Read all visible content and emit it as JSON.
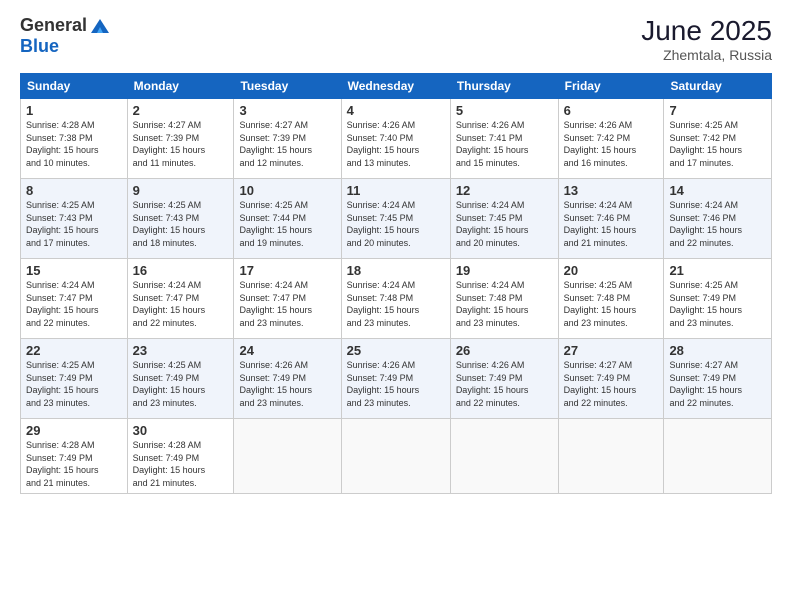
{
  "header": {
    "logo_general": "General",
    "logo_blue": "Blue",
    "title": "June 2025",
    "location": "Zhemtala, Russia"
  },
  "days_of_week": [
    "Sunday",
    "Monday",
    "Tuesday",
    "Wednesday",
    "Thursday",
    "Friday",
    "Saturday"
  ],
  "weeks": [
    [
      {
        "day": 1,
        "info": "Sunrise: 4:28 AM\nSunset: 7:38 PM\nDaylight: 15 hours\nand 10 minutes."
      },
      {
        "day": 2,
        "info": "Sunrise: 4:27 AM\nSunset: 7:39 PM\nDaylight: 15 hours\nand 11 minutes."
      },
      {
        "day": 3,
        "info": "Sunrise: 4:27 AM\nSunset: 7:39 PM\nDaylight: 15 hours\nand 12 minutes."
      },
      {
        "day": 4,
        "info": "Sunrise: 4:26 AM\nSunset: 7:40 PM\nDaylight: 15 hours\nand 13 minutes."
      },
      {
        "day": 5,
        "info": "Sunrise: 4:26 AM\nSunset: 7:41 PM\nDaylight: 15 hours\nand 15 minutes."
      },
      {
        "day": 6,
        "info": "Sunrise: 4:26 AM\nSunset: 7:42 PM\nDaylight: 15 hours\nand 16 minutes."
      },
      {
        "day": 7,
        "info": "Sunrise: 4:25 AM\nSunset: 7:42 PM\nDaylight: 15 hours\nand 17 minutes."
      }
    ],
    [
      {
        "day": 8,
        "info": "Sunrise: 4:25 AM\nSunset: 7:43 PM\nDaylight: 15 hours\nand 17 minutes."
      },
      {
        "day": 9,
        "info": "Sunrise: 4:25 AM\nSunset: 7:43 PM\nDaylight: 15 hours\nand 18 minutes."
      },
      {
        "day": 10,
        "info": "Sunrise: 4:25 AM\nSunset: 7:44 PM\nDaylight: 15 hours\nand 19 minutes."
      },
      {
        "day": 11,
        "info": "Sunrise: 4:24 AM\nSunset: 7:45 PM\nDaylight: 15 hours\nand 20 minutes."
      },
      {
        "day": 12,
        "info": "Sunrise: 4:24 AM\nSunset: 7:45 PM\nDaylight: 15 hours\nand 20 minutes."
      },
      {
        "day": 13,
        "info": "Sunrise: 4:24 AM\nSunset: 7:46 PM\nDaylight: 15 hours\nand 21 minutes."
      },
      {
        "day": 14,
        "info": "Sunrise: 4:24 AM\nSunset: 7:46 PM\nDaylight: 15 hours\nand 22 minutes."
      }
    ],
    [
      {
        "day": 15,
        "info": "Sunrise: 4:24 AM\nSunset: 7:47 PM\nDaylight: 15 hours\nand 22 minutes."
      },
      {
        "day": 16,
        "info": "Sunrise: 4:24 AM\nSunset: 7:47 PM\nDaylight: 15 hours\nand 22 minutes."
      },
      {
        "day": 17,
        "info": "Sunrise: 4:24 AM\nSunset: 7:47 PM\nDaylight: 15 hours\nand 23 minutes."
      },
      {
        "day": 18,
        "info": "Sunrise: 4:24 AM\nSunset: 7:48 PM\nDaylight: 15 hours\nand 23 minutes."
      },
      {
        "day": 19,
        "info": "Sunrise: 4:24 AM\nSunset: 7:48 PM\nDaylight: 15 hours\nand 23 minutes."
      },
      {
        "day": 20,
        "info": "Sunrise: 4:25 AM\nSunset: 7:48 PM\nDaylight: 15 hours\nand 23 minutes."
      },
      {
        "day": 21,
        "info": "Sunrise: 4:25 AM\nSunset: 7:49 PM\nDaylight: 15 hours\nand 23 minutes."
      }
    ],
    [
      {
        "day": 22,
        "info": "Sunrise: 4:25 AM\nSunset: 7:49 PM\nDaylight: 15 hours\nand 23 minutes."
      },
      {
        "day": 23,
        "info": "Sunrise: 4:25 AM\nSunset: 7:49 PM\nDaylight: 15 hours\nand 23 minutes."
      },
      {
        "day": 24,
        "info": "Sunrise: 4:26 AM\nSunset: 7:49 PM\nDaylight: 15 hours\nand 23 minutes."
      },
      {
        "day": 25,
        "info": "Sunrise: 4:26 AM\nSunset: 7:49 PM\nDaylight: 15 hours\nand 23 minutes."
      },
      {
        "day": 26,
        "info": "Sunrise: 4:26 AM\nSunset: 7:49 PM\nDaylight: 15 hours\nand 22 minutes."
      },
      {
        "day": 27,
        "info": "Sunrise: 4:27 AM\nSunset: 7:49 PM\nDaylight: 15 hours\nand 22 minutes."
      },
      {
        "day": 28,
        "info": "Sunrise: 4:27 AM\nSunset: 7:49 PM\nDaylight: 15 hours\nand 22 minutes."
      }
    ],
    [
      {
        "day": 29,
        "info": "Sunrise: 4:28 AM\nSunset: 7:49 PM\nDaylight: 15 hours\nand 21 minutes."
      },
      {
        "day": 30,
        "info": "Sunrise: 4:28 AM\nSunset: 7:49 PM\nDaylight: 15 hours\nand 21 minutes."
      },
      null,
      null,
      null,
      null,
      null
    ]
  ]
}
